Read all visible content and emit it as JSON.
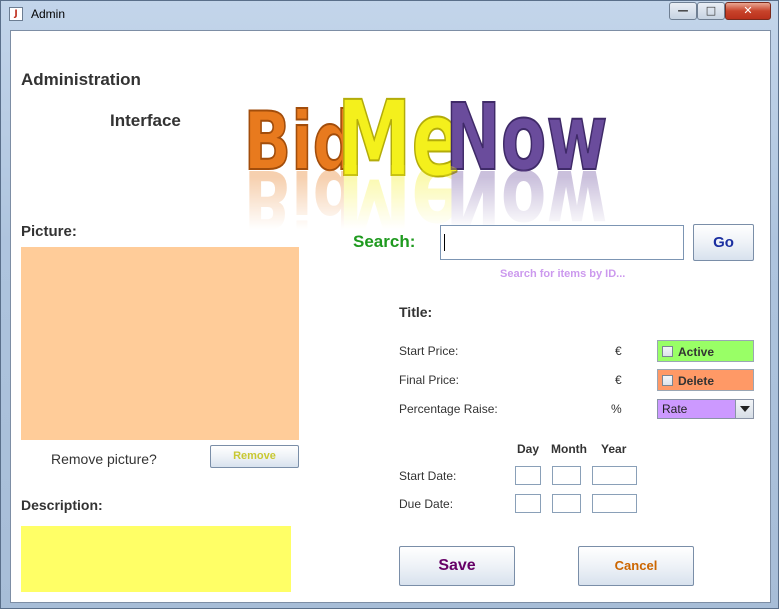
{
  "window": {
    "title": "Admin",
    "icon": "java-coffee-icon",
    "controls": [
      "minimize-icon",
      "maximize-icon",
      "close-icon"
    ]
  },
  "header": {
    "line1": "Administration",
    "line2": "Interface",
    "logo_text": "BidMeNow",
    "logo_colors": {
      "bid": "#e87a1e",
      "me": "#f4f01c",
      "now": "#6a4c9c"
    }
  },
  "picture": {
    "label": "Picture:",
    "box_color": "#ffcc99",
    "remove_prompt": "Remove picture?",
    "remove_button": "Remove",
    "remove_color": "#c8c833"
  },
  "description": {
    "label": "Description:",
    "box_color": "#ffff66"
  },
  "search": {
    "label": "Search:",
    "label_color": "#1f9a1f",
    "value": "",
    "hint": "Search for items by ID...",
    "hint_color": "#cc99ee",
    "go_button": "Go",
    "go_color": "#1a2ea0"
  },
  "item": {
    "title_label": "Title:",
    "start_price_label": "Start Price:",
    "start_price_unit": "€",
    "final_price_label": "Final Price:",
    "final_price_unit": "€",
    "percentage_label": "Percentage Raise:",
    "percentage_unit": "%",
    "active_label": "Active",
    "active_color": "#99ff66",
    "delete_label": "Delete",
    "delete_color": "#ff9966",
    "rate_selected": "Rate",
    "rate_color": "#cc99ff"
  },
  "dates": {
    "day_label": "Day",
    "month_label": "Month",
    "year_label": "Year",
    "start_label": "Start Date:",
    "due_label": "Due Date:"
  },
  "actions": {
    "save_label": "Save",
    "save_color": "#660066",
    "cancel_label": "Cancel",
    "cancel_color": "#cc6600"
  }
}
